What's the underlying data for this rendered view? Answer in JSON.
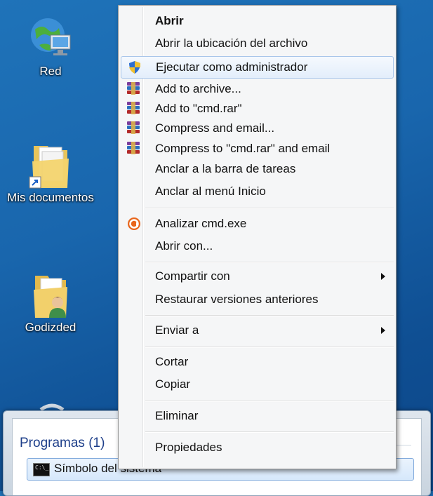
{
  "desktop": {
    "icons": [
      {
        "label": "Red",
        "icon": "network-icon"
      },
      {
        "label": "Mis documentos",
        "icon": "documents-folder-icon"
      },
      {
        "label": "Godizded",
        "icon": "user-folder-icon"
      }
    ]
  },
  "context_menu": {
    "items": [
      {
        "label": "Abrir"
      },
      {
        "label": "Abrir la ubicación del archivo"
      },
      {
        "label": "Ejecutar como administrador"
      },
      {
        "label": "Add to archive..."
      },
      {
        "label": "Add to \"cmd.rar\""
      },
      {
        "label": "Compress and email..."
      },
      {
        "label": "Compress to \"cmd.rar\" and email"
      },
      {
        "label": "Anclar a la barra de tareas"
      },
      {
        "label": "Anclar al menú Inicio"
      },
      {
        "label": "Analizar cmd.exe"
      },
      {
        "label": "Abrir con..."
      },
      {
        "label": "Compartir con"
      },
      {
        "label": "Restaurar versiones anteriores"
      },
      {
        "label": "Enviar a"
      },
      {
        "label": "Cortar"
      },
      {
        "label": "Copiar"
      },
      {
        "label": "Eliminar"
      },
      {
        "label": "Propiedades"
      }
    ]
  },
  "start_menu": {
    "section_header": "Programas (1)",
    "result": "Símbolo del sistema"
  },
  "colors": {
    "desktop": "#1966ad",
    "highlight_border": "#a9c6ea",
    "section_header": "#1e3f8a"
  }
}
